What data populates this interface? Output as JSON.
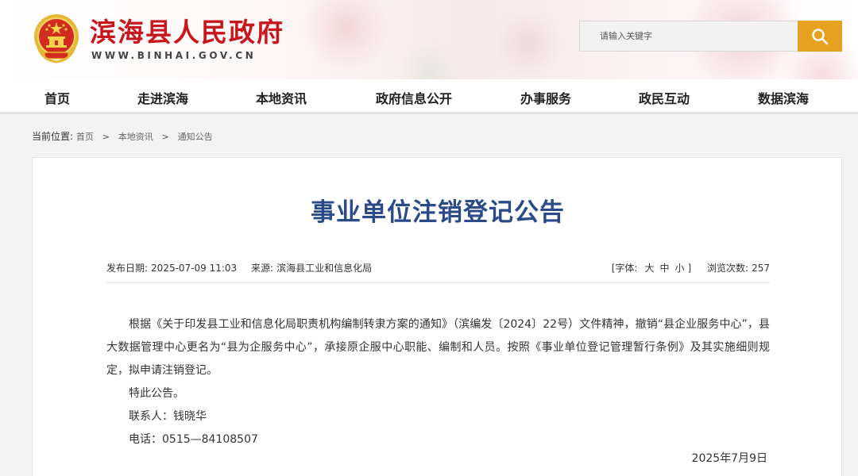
{
  "header": {
    "title": "滨海县人民政府",
    "url": "WWW.BINHAI.GOV.CN",
    "search": {
      "placeholder": "请输入关键字"
    },
    "colors": {
      "brand_red": "#c8161d",
      "search_button": "#e6a11f",
      "title_blue": "#2a4a8a"
    }
  },
  "nav": {
    "items": [
      {
        "label": "首页"
      },
      {
        "label": "走进滨海"
      },
      {
        "label": "本地资讯"
      },
      {
        "label": "政府信息公开"
      },
      {
        "label": "办事服务"
      },
      {
        "label": "政民互动"
      },
      {
        "label": "数据滨海"
      }
    ]
  },
  "breadcrumb": {
    "label": "当前位置:",
    "items": [
      "首页",
      "本地资讯",
      "通知公告"
    ],
    "separator": ">"
  },
  "article": {
    "title": "事业单位注销登记公告",
    "meta": {
      "date_label": "发布日期:",
      "date": "2025-07-09 11:03",
      "source_label": "来源:",
      "source": "滨海县工业和信息化局",
      "font_label": "[字体:",
      "font_large": "大",
      "font_medium": "中",
      "font_small": "小",
      "font_close": "]",
      "views_label": "浏览次数:",
      "views": "257"
    },
    "paragraph": "根据《关于印发县工业和信息化局职责机构编制转隶方案的通知》（滨编发〔2024〕22号）文件精神，撤销“县企业服务中心”，县大数据管理中心更名为“县为企服务中心”，承接原企服中心职能、编制和人员。按照《事业单位登记管理暂行条例》及其实施细则规定，拟申请注销登记。",
    "closing": "特此公告。",
    "contact": "联系人：钱晓华",
    "phone": "电话：0515—84108507",
    "sign_date": "2025年7月9日"
  }
}
